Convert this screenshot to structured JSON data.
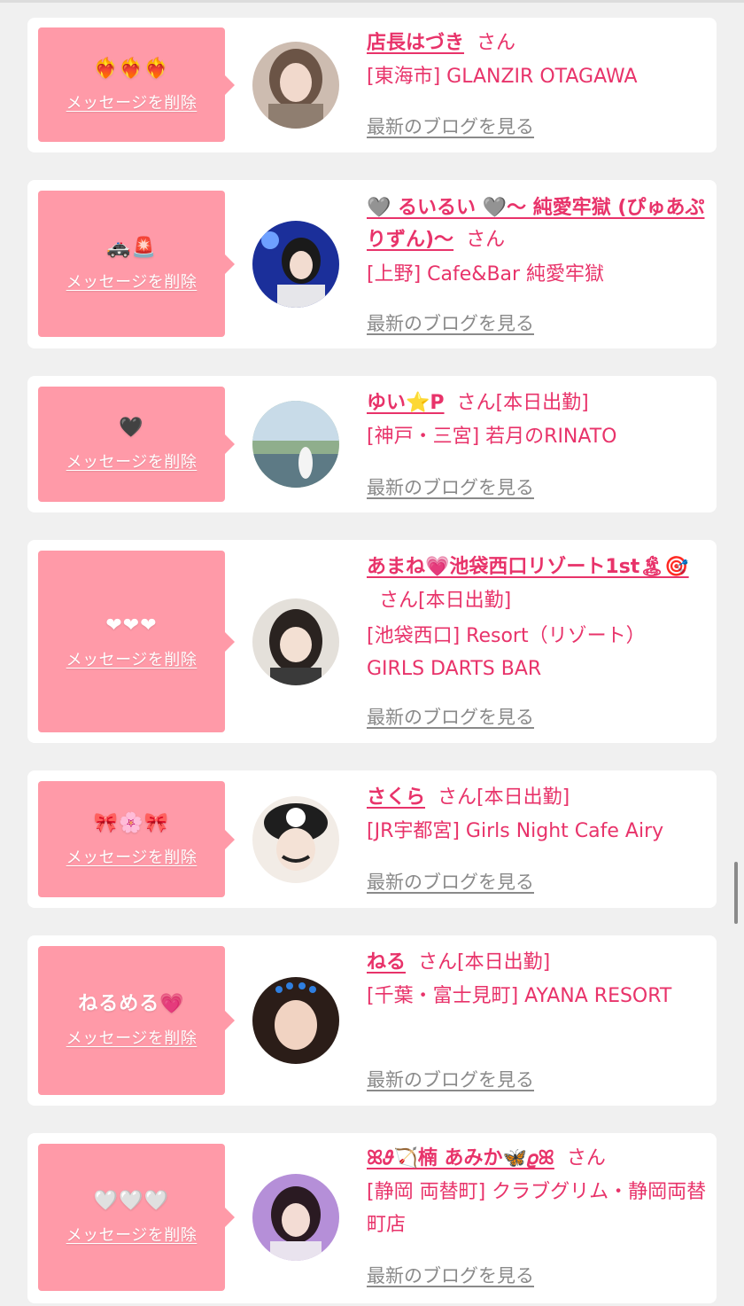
{
  "cards": [
    {
      "message": "❤️‍🔥❤️‍🔥❤️‍🔥",
      "delete_label": "メッセージを削除",
      "name": "店長はづき",
      "suffix": "さん",
      "status": "",
      "shop": "[東海市] GLANZIR OTAGAWA",
      "blog_label": "最新のブログを見る"
    },
    {
      "message": "🚓🚨",
      "delete_label": "メッセージを削除",
      "name": "🩶 るいるい 🩶〜 純愛牢獄 (ぴゅあぷりずん)〜",
      "suffix": "さん",
      "status": "",
      "shop": "[上野] Cafe&Bar 純愛牢獄",
      "blog_label": "最新のブログを見る"
    },
    {
      "message": "🖤",
      "delete_label": "メッセージを削除",
      "name": "ゆい⭐P",
      "suffix": "さん",
      "status": "[本日出勤]",
      "shop": "[神戸・三宮] 若月のRINATO",
      "blog_label": "最新のブログを見る"
    },
    {
      "message": "❤︎❤︎❤︎",
      "delete_label": "メッセージを削除",
      "name": "あまね💗池袋西口リゾート1st🏝🎯",
      "suffix": "さん",
      "status": "[本日出勤]",
      "shop": "[池袋西口] Resort（リゾート） GIRLS DARTS BAR",
      "blog_label": "最新のブログを見る"
    },
    {
      "message": "🎀🌸🎀",
      "delete_label": "メッセージを削除",
      "name": "さくら",
      "suffix": "さん",
      "status": "[本日出勤]",
      "shop": "[JR宇都宮] Girls Night Cafe Airy",
      "blog_label": "最新のブログを見る"
    },
    {
      "message": "ねるめる💗",
      "delete_label": "メッセージを削除",
      "name": "ねる",
      "suffix": "さん",
      "status": "[本日出勤]",
      "shop": "[千葉・富士見町] AYANA RESORT",
      "blog_label": "最新のブログを見る"
    },
    {
      "message": "🤍🤍🤍",
      "delete_label": "メッセージを削除",
      "name": "ꕤ𝜗🏹楠 あみか🦋𝜚ꕤ",
      "suffix": "さん",
      "status": "",
      "shop": "[静岡 両替町] クラブグリム・静岡両替町店",
      "blog_label": "最新のブログを見る"
    }
  ],
  "colors": {
    "accent": "#e8336a",
    "message_box": "#ff9aa8",
    "card_bg": "#ffffff",
    "page_bg": "#f0f0f0",
    "blog_link": "#8a8a8a"
  }
}
